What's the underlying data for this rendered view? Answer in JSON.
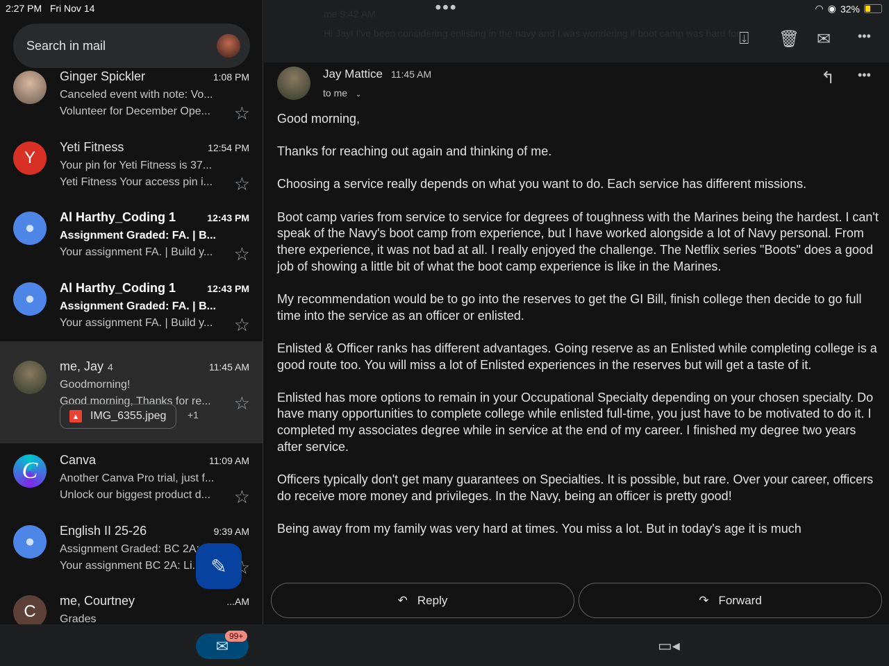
{
  "status": {
    "time": "2:27 PM",
    "date": "Fri Nov 14",
    "battery": "32%",
    "battery_level": 0.32
  },
  "search": {
    "placeholder": "Search in mail"
  },
  "emails": [
    {
      "sender": "Ginger Spickler",
      "time": "1:08 PM",
      "subject": "Canceled event with note: Vo...",
      "snippet": "Volunteer for December Ope...",
      "unread": false,
      "avatar": "photo"
    },
    {
      "sender": "Yeti Fitness",
      "time": "12:54 PM",
      "subject": "Your pin for Yeti Fitness is 37...",
      "snippet": "Yeti Fitness Your access pin i...",
      "unread": false,
      "avatar": "Y",
      "avatar_color": "#d93025"
    },
    {
      "sender": "Al Harthy_Coding 1",
      "time": "12:43 PM",
      "subject": "Assignment Graded: FA. | B...",
      "snippet": "Your assignment FA. | Build y...",
      "unread": true,
      "avatar": "person",
      "avatar_color": "#4e86e8"
    },
    {
      "sender": "Al Harthy_Coding 1",
      "time": "12:43 PM",
      "subject": "Assignment Graded: FA. | B...",
      "snippet": "Your assignment FA. | Build y...",
      "unread": true,
      "avatar": "person",
      "avatar_color": "#4e86e8"
    },
    {
      "sender": "me, Jay",
      "count": "4",
      "time": "11:45 AM",
      "subject": "Goodmorning!",
      "snippet": "Good morning, Thanks for re...",
      "attachment": "IMG_6355.jpeg",
      "more_attachments": "+1",
      "selected": true,
      "avatar": "photo"
    },
    {
      "sender": "Canva",
      "time": "11:09 AM",
      "subject": "Another Canva Pro trial, just f...",
      "snippet": "Unlock our biggest product d...",
      "avatar": "C"
    },
    {
      "sender": "English II 25-26",
      "time": "9:39 AM",
      "subject": "Assignment Graded: BC 2A:...",
      "snippet": "Your assignment BC 2A: Li...",
      "avatar": "person",
      "avatar_color": "#4e86e8"
    },
    {
      "sender": "me, Courtney",
      "time": "...AM",
      "subject": "Grades",
      "avatar": "C",
      "avatar_color": "#5d4037"
    }
  ],
  "compose_icon": "pencil-icon",
  "mail_badge": "99+",
  "thread": {
    "prev_header": "me 9:42 AM",
    "prev_snippet": "Hi Jay! I've been considering enlisting in the navy and I was wondering if boot camp was hard for you and...",
    "sender": "Jay Mattice",
    "time": "11:45 AM",
    "to": "to me",
    "paragraphs": [
      "Good morning,",
      "Thanks for reaching out again and thinking of me.",
      "Choosing a service really depends on what you want to do. Each service has different missions.",
      "Boot camp varies from service to service for degrees of toughness with the Marines being the hardest. I can't speak of the Navy's boot camp from experience, but I have worked alongside a lot of Navy personal. From there experience, it was not bad at all. I really enjoyed the challenge. The Netflix series \"Boots\" does a good job of showing a little bit of what the boot camp experience is like in the Marines.",
      "My recommendation would be to go into the reserves to get the GI Bill, finish college then decide to go full time into the service as an officer or enlisted.",
      "Enlisted & Officer ranks has different advantages. Going reserve as an Enlisted while completing college is a good route too. You will miss a lot of Enlisted experiences in the reserves but will get a taste of it.",
      "Enlisted has more options to remain in your Occupational Specialty depending on your chosen specialty. Do have many opportunities to complete college while enlisted full-time, you just have to be motivated to do it. I completed my associates degree while in service at the end of my career. I finished my degree two years after service.",
      "Officers typically don't get many guarantees on Specialties. It is possible, but rare. Over your career, officers do receive more money and privileges. In the Navy, being an officer is pretty good!",
      "Being away from my family was very hard at times. You miss a lot. But in today's age it is much"
    ],
    "reply_label": "Reply",
    "forward_label": "Forward"
  }
}
